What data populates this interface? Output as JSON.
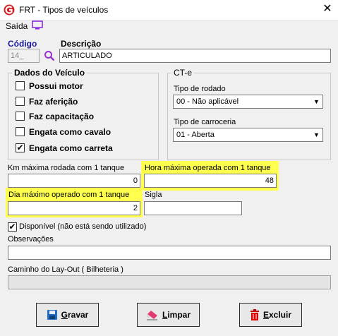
{
  "window": {
    "title": "FRT - Tipos de veículos",
    "close_glyph": "✕"
  },
  "menu": {
    "saida": "Saída"
  },
  "codigo": {
    "label": "Código",
    "value": "14_"
  },
  "descricao": {
    "label": "Descrição",
    "value": "ARTICULADO"
  },
  "dados": {
    "title": "Dados do Veículo",
    "items": [
      {
        "label": "Possui motor",
        "checked": false
      },
      {
        "label": "Faz aferição",
        "checked": false
      },
      {
        "label": "Faz capacitação",
        "checked": false
      },
      {
        "label": "Engata como cavalo",
        "checked": false
      },
      {
        "label": "Engata como carreta",
        "checked": true
      }
    ]
  },
  "cte": {
    "title": "CT-e",
    "rodado_label": "Tipo de rodado",
    "rodado_value": "00 - Não aplicável",
    "carroceria_label": "Tipo de carroceria",
    "carroceria_value": "01 - Aberta"
  },
  "km": {
    "label": "Km máxima rodada com 1 tanque",
    "value": "0"
  },
  "hora": {
    "label": "Hora máxima operada com 1 tanque",
    "value": "48"
  },
  "dia": {
    "label": "Dia máximo operado com 1 tanque",
    "value": "2"
  },
  "sigla": {
    "label": "Sigla",
    "value": ""
  },
  "disponivel": {
    "label": "Disponível (não está sendo utilizado)",
    "checked": true
  },
  "observacoes": {
    "label": "Observações",
    "value": ""
  },
  "layout": {
    "label": "Caminho do Lay-Out ( Bilheteria )",
    "value": ""
  },
  "buttons": {
    "gravar": {
      "first": "G",
      "rest": "ravar"
    },
    "limpar": {
      "first": "L",
      "rest": "impar"
    },
    "excluir": {
      "first": "E",
      "rest": "xcluir"
    }
  },
  "colors": {
    "highlight": "#ffff4d",
    "accent": "#1a1a9a"
  }
}
